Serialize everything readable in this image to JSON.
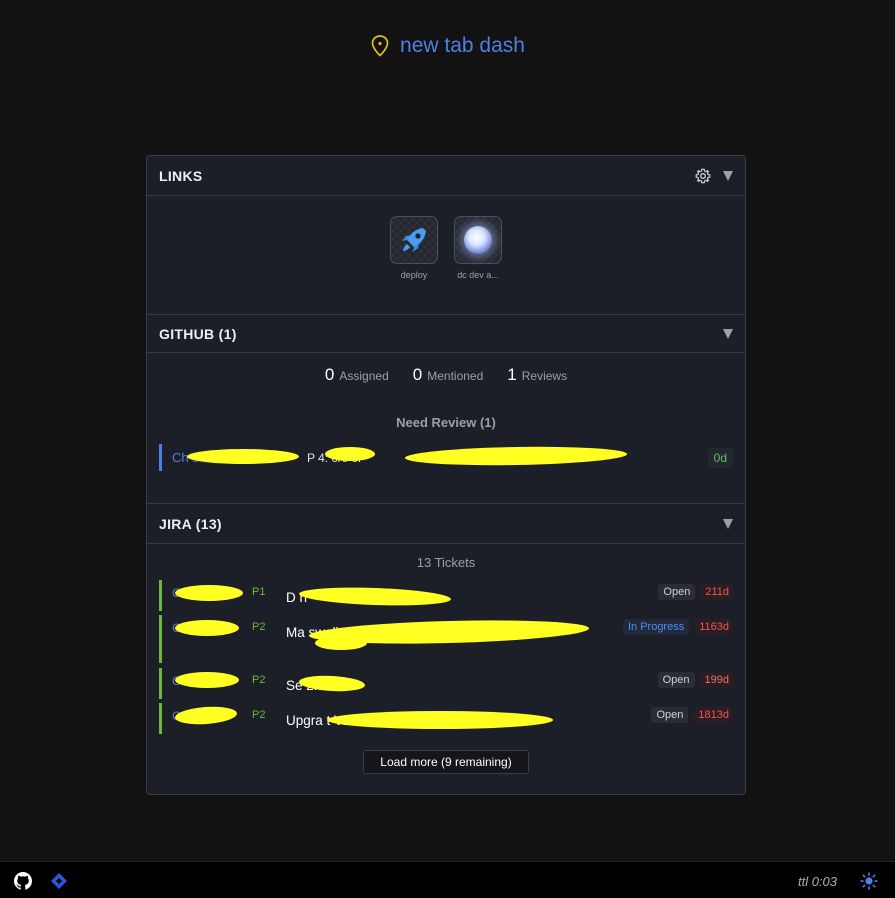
{
  "header": {
    "title": "new tab dash",
    "icon": "map-pin-icon",
    "icon_color": "#e5c012",
    "title_color": "#4f7fe6"
  },
  "links": {
    "title": "LINKS",
    "items": [
      {
        "label": "deploy",
        "icon": "rocket-icon"
      },
      {
        "label": "dc dev a...",
        "icon": "globe-icon"
      }
    ]
  },
  "github": {
    "title": "GITHUB (1)",
    "stats": [
      {
        "count": "0",
        "label": "Assigned"
      },
      {
        "count": "0",
        "label": "Mentioned"
      },
      {
        "count": "1",
        "label": "Reviews"
      }
    ],
    "need_review_label": "Need Review (1)",
    "prs": [
      {
        "repo": "Ch                    s",
        "title": "P            4: cre                                          er",
        "age": "0d"
      }
    ]
  },
  "jira": {
    "title": "JIRA (13)",
    "count_label": "13 Tickets",
    "tickets": [
      {
        "key": "C",
        "priority": "P1",
        "title": "D                                  n",
        "status": "Open",
        "age": "211d"
      },
      {
        "key": "C",
        "priority": "P2",
        "title": "Ma                                                          swell 10k                , alert",
        "status": "In Progress",
        "age": "1163d"
      },
      {
        "key": "C",
        "priority": "P2",
        "title": "Se                  2.0",
        "status": "Open",
        "age": "199d"
      },
      {
        "key": "C",
        "priority": "P2",
        "title": "Upgra                                              t V2",
        "status": "Open",
        "age": "1813d"
      }
    ],
    "load_more_label": "Load more (9 remaining)"
  },
  "footer": {
    "ttl": "ttl 0:03",
    "left_icons": [
      "github-icon",
      "jira-icon"
    ],
    "right_icon": "sun-icon"
  }
}
